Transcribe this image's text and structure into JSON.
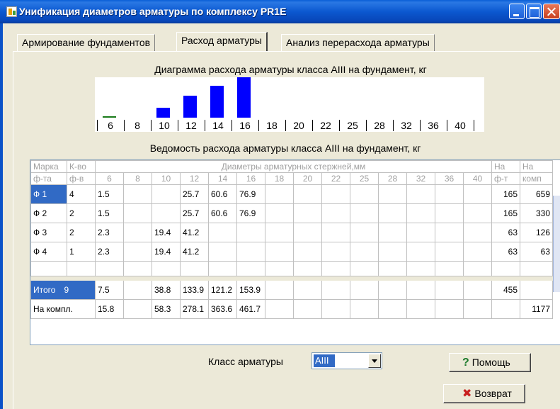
{
  "window": {
    "title": "Унификация диаметров арматуры по комплексу PR1E"
  },
  "tabs": [
    "Армирование фундаментов",
    "Расход арматуры",
    "Анализ перерасхода арматуры"
  ],
  "chart_title": "Диаграмма расхода арматуры класса AIII на фундамент, кг",
  "table_title": "Ведомость расхода арматуры класса AIII на фундамент, кг",
  "chart_data": {
    "type": "bar",
    "categories": [
      "6",
      "8",
      "10",
      "12",
      "14",
      "16",
      "18",
      "20",
      "22",
      "25",
      "28",
      "32",
      "36",
      "40"
    ],
    "values": [
      2.3,
      0,
      19.4,
      41.2,
      60.6,
      76.9,
      0,
      0,
      0,
      0,
      0,
      0,
      0,
      0
    ],
    "colors": [
      "#1a7a1a",
      "#0000ff",
      "#0000ff",
      "#0000ff",
      "#0000ff",
      "#0000ff",
      "#0000ff",
      "#0000ff",
      "#0000ff",
      "#0000ff",
      "#0000ff",
      "#0000ff",
      "#0000ff",
      "#0000ff"
    ],
    "title": "Диаграмма расхода арматуры класса AIII на фундамент, кг",
    "ylim": [
      0,
      76.9
    ],
    "grid": false
  },
  "grid": {
    "header1": {
      "mark": "Марка",
      "count": "К-во",
      "diam": "Диаметры арматурных стержней,мм",
      "per_f": "На",
      "per_k": "На"
    },
    "header2": {
      "mark": "ф-та",
      "count": "ф-в",
      "per_f": "ф-т",
      "per_k": "комп"
    },
    "diameters": [
      "6",
      "8",
      "10",
      "12",
      "14",
      "16",
      "18",
      "20",
      "22",
      "25",
      "28",
      "32",
      "36",
      "40"
    ],
    "rows": [
      {
        "mark": "Ф  1",
        "count": "4",
        "d": [
          "1.5",
          "",
          "",
          "25.7",
          "60.6",
          "76.9",
          "",
          "",
          "",
          "",
          "",
          "",
          "",
          ""
        ],
        "per_f": "165",
        "per_k": "659"
      },
      {
        "mark": "Ф  2",
        "count": "2",
        "d": [
          "1.5",
          "",
          "",
          "25.7",
          "60.6",
          "76.9",
          "",
          "",
          "",
          "",
          "",
          "",
          "",
          ""
        ],
        "per_f": "165",
        "per_k": "330"
      },
      {
        "mark": "Ф  3",
        "count": "2",
        "d": [
          "2.3",
          "",
          "19.4",
          "41.2",
          "",
          "",
          "",
          "",
          "",
          "",
          "",
          "",
          "",
          ""
        ],
        "per_f": "63",
        "per_k": "126"
      },
      {
        "mark": "Ф  4",
        "count": "1",
        "d": [
          "2.3",
          "",
          "19.4",
          "41.2",
          "",
          "",
          "",
          "",
          "",
          "",
          "",
          "",
          "",
          ""
        ],
        "per_f": "63",
        "per_k": "63"
      }
    ],
    "total": {
      "label": "Итого",
      "count": "9",
      "d": [
        "7.5",
        "",
        "38.8",
        "133.9",
        "121.2",
        "153.9",
        "",
        "",
        "",
        "",
        "",
        "",
        "",
        ""
      ],
      "per_f": "455",
      "per_k": ""
    },
    "per_complex": {
      "label": "На компл.",
      "d": [
        "15.8",
        "",
        "58.3",
        "278.1",
        "363.6",
        "461.7",
        "",
        "",
        "",
        "",
        "",
        "",
        "",
        ""
      ],
      "per_f": "",
      "per_k": "1177"
    }
  },
  "controls": {
    "class_label": "Класс арматуры",
    "class_value": "AIII",
    "help_label": "Помощь",
    "back_label": "Возврат"
  },
  "icons": {
    "help": "question-icon",
    "back": "cross-icon"
  }
}
